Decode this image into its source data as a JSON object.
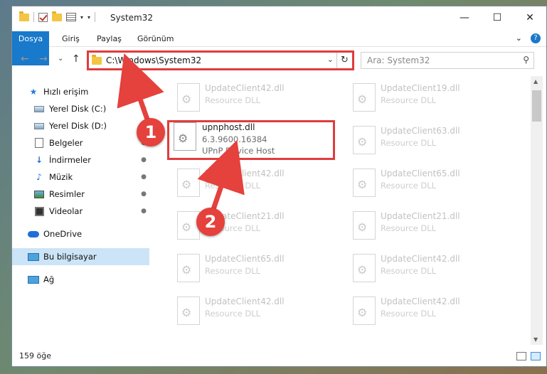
{
  "window": {
    "title": "System32",
    "controls": {
      "minimize": "—",
      "maximize": "☐",
      "close": "✕"
    }
  },
  "quick_access_toolbar": {
    "dropdown": "▾",
    "separator": "|"
  },
  "ribbon": {
    "tabs": [
      "Dosya",
      "Giriş",
      "Paylaş",
      "Görünüm"
    ],
    "expand": "⌄",
    "help": "?"
  },
  "navigation": {
    "back": "←",
    "forward": "→",
    "recent": "⌄",
    "up": "↑"
  },
  "address": {
    "path": "C:\\Windows\\System32",
    "dropdown": "⌄",
    "refresh": "↻"
  },
  "search": {
    "placeholder": "Ara: System32",
    "icon": "search-icon"
  },
  "nav_pane": {
    "items": [
      {
        "label": "Hızlı erişim",
        "icon": "star-icon",
        "pinned": false
      },
      {
        "label": "Yerel Disk (C:)",
        "icon": "drive-icon",
        "pinned": true
      },
      {
        "label": "Yerel Disk (D:)",
        "icon": "drive-icon",
        "pinned": true
      },
      {
        "label": "Belgeler",
        "icon": "documents-icon",
        "pinned": true
      },
      {
        "label": "İndirmeler",
        "icon": "download-icon",
        "pinned": true
      },
      {
        "label": "Müzik",
        "icon": "music-icon",
        "pinned": true
      },
      {
        "label": "Resimler",
        "icon": "pictures-icon",
        "pinned": true
      },
      {
        "label": "Videolar",
        "icon": "videos-icon",
        "pinned": true
      },
      {
        "label": "OneDrive",
        "icon": "cloud-icon",
        "pinned": false
      },
      {
        "label": "Bu bilgisayar",
        "icon": "computer-icon",
        "pinned": false,
        "selected": true
      },
      {
        "label": "Ağ",
        "icon": "network-icon",
        "pinned": false
      }
    ],
    "pin_glyph": "📌"
  },
  "files": [
    {
      "name": "UpdateClient42.dll",
      "description": "Resource DLL"
    },
    {
      "name": "UpdateClient19.dll",
      "description": "Resource DLL"
    },
    {
      "name": "upnphost.dll",
      "version": "6.3.9600.16384",
      "description": "UPnP Device Host",
      "highlighted": true
    },
    {
      "name": "UpdateClient63.dll",
      "description": "Resource DLL"
    },
    {
      "name": "UpdateClient42.dll",
      "description": "Resource DLL"
    },
    {
      "name": "UpdateClient65.dll",
      "description": "Resource DLL"
    },
    {
      "name": "UpdateClient21.dll",
      "description": "Resource DLL"
    },
    {
      "name": "UpdateClient21.dll",
      "description": "Resource DLL"
    },
    {
      "name": "UpdateClient65.dll",
      "description": "Resource DLL"
    },
    {
      "name": "UpdateClient42.dll",
      "description": "Resource DLL"
    },
    {
      "name": "UpdateClient42.dll",
      "description": "Resource DLL"
    },
    {
      "name": "UpdateClient42.dll",
      "description": "Resource DLL"
    }
  ],
  "status": {
    "item_count": "159 öğe"
  },
  "annotations": {
    "step1": "1",
    "step2": "2",
    "color": "#e5413d"
  },
  "scrollbar": {
    "up": "▲",
    "down": "▼"
  }
}
